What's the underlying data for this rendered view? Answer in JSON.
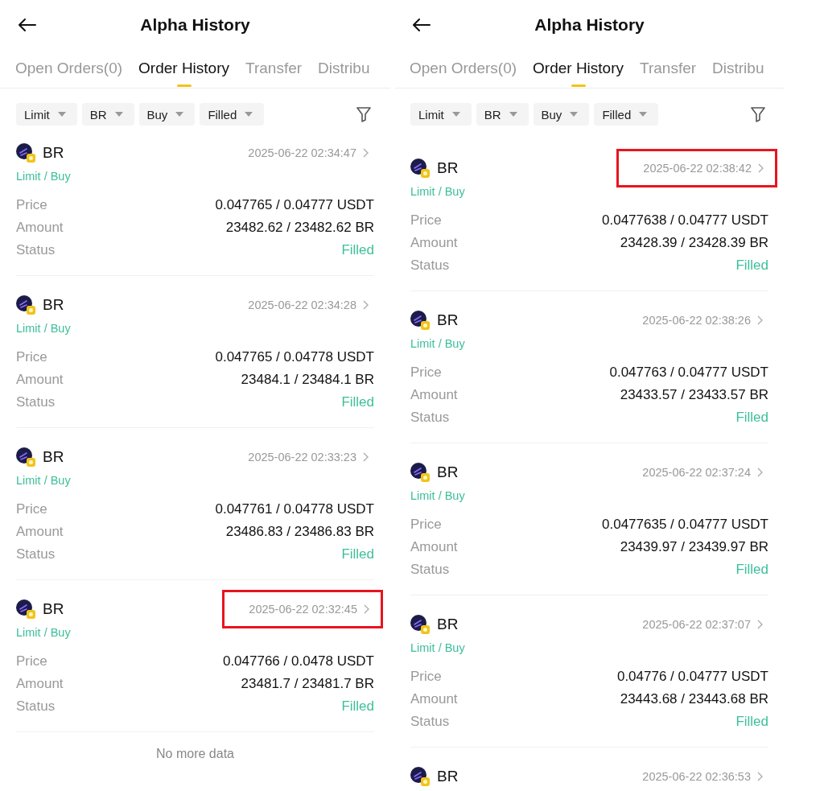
{
  "panels": [
    {
      "title": "Alpha History",
      "tabs": [
        {
          "label": "Open Orders(0)",
          "selected": false
        },
        {
          "label": "Order History",
          "selected": true
        },
        {
          "label": "Transfer",
          "selected": false
        },
        {
          "label": "Distribu",
          "selected": false
        }
      ],
      "filters": [
        "Limit",
        "BR",
        "Buy",
        "Filled"
      ],
      "orders": [
        {
          "symbol": "BR",
          "time": "2025-06-22 02:34:47",
          "highlighted": false,
          "type": "Limit / Buy",
          "rows": [
            {
              "label": "Price",
              "value": "0.047765 / 0.04777 USDT"
            },
            {
              "label": "Amount",
              "value": "23482.62 / 23482.62 BR"
            },
            {
              "label": "Status",
              "value": "Filled",
              "kind": "status"
            }
          ]
        },
        {
          "symbol": "BR",
          "time": "2025-06-22 02:34:28",
          "highlighted": false,
          "type": "Limit / Buy",
          "rows": [
            {
              "label": "Price",
              "value": "0.047765 / 0.04778 USDT"
            },
            {
              "label": "Amount",
              "value": "23484.1 / 23484.1 BR"
            },
            {
              "label": "Status",
              "value": "Filled",
              "kind": "status"
            }
          ]
        },
        {
          "symbol": "BR",
          "time": "2025-06-22 02:33:23",
          "highlighted": false,
          "type": "Limit / Buy",
          "rows": [
            {
              "label": "Price",
              "value": "0.047761 / 0.04778 USDT"
            },
            {
              "label": "Amount",
              "value": "23486.83 / 23486.83 BR"
            },
            {
              "label": "Status",
              "value": "Filled",
              "kind": "status"
            }
          ]
        },
        {
          "symbol": "BR",
          "time": "2025-06-22 02:32:45",
          "highlighted": true,
          "type": "Limit / Buy",
          "rows": [
            {
              "label": "Price",
              "value": "0.047766 / 0.0478 USDT"
            },
            {
              "label": "Amount",
              "value": "23481.7 / 23481.7 BR"
            },
            {
              "label": "Status",
              "value": "Filled",
              "kind": "status"
            }
          ]
        }
      ],
      "footer": "No more data"
    },
    {
      "title": "Alpha History",
      "tabs": [
        {
          "label": "Open Orders(0)",
          "selected": false
        },
        {
          "label": "Order History",
          "selected": true
        },
        {
          "label": "Transfer",
          "selected": false
        },
        {
          "label": "Distribu",
          "selected": false
        }
      ],
      "filters": [
        "Limit",
        "BR",
        "Buy",
        "Filled"
      ],
      "orders": [
        {
          "symbol": "BR",
          "time": "2025-06-22 02:38:42",
          "highlighted": true,
          "type": "Limit / Buy",
          "rows": [
            {
              "label": "Price",
              "value": "0.0477638 / 0.04777 USDT"
            },
            {
              "label": "Amount",
              "value": "23428.39 / 23428.39 BR"
            },
            {
              "label": "Status",
              "value": "Filled",
              "kind": "status"
            }
          ]
        },
        {
          "symbol": "BR",
          "time": "2025-06-22 02:38:26",
          "highlighted": false,
          "type": "Limit / Buy",
          "rows": [
            {
              "label": "Price",
              "value": "0.047763 / 0.04777 USDT"
            },
            {
              "label": "Amount",
              "value": "23433.57 / 23433.57 BR"
            },
            {
              "label": "Status",
              "value": "Filled",
              "kind": "status"
            }
          ]
        },
        {
          "symbol": "BR",
          "time": "2025-06-22 02:37:24",
          "highlighted": false,
          "type": "Limit / Buy",
          "rows": [
            {
              "label": "Price",
              "value": "0.0477635 / 0.04777 USDT"
            },
            {
              "label": "Amount",
              "value": "23439.97 / 23439.97 BR"
            },
            {
              "label": "Status",
              "value": "Filled",
              "kind": "status"
            }
          ]
        },
        {
          "symbol": "BR",
          "time": "2025-06-22 02:37:07",
          "highlighted": false,
          "type": "Limit / Buy",
          "rows": [
            {
              "label": "Price",
              "value": "0.04776 / 0.04777 USDT"
            },
            {
              "label": "Amount",
              "value": "23443.68 / 23443.68 BR"
            },
            {
              "label": "Status",
              "value": "Filled",
              "kind": "status"
            }
          ]
        },
        {
          "symbol": "BR",
          "time": "2025-06-22 02:36:53",
          "highlighted": false
        }
      ]
    }
  ]
}
